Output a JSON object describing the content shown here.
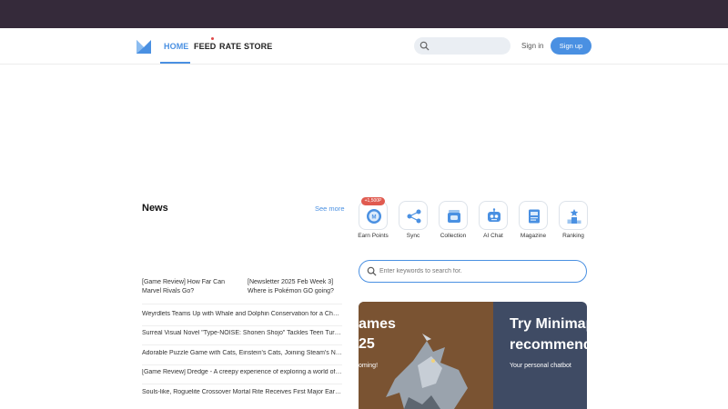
{
  "nav": {
    "links": [
      "HOME",
      "FEED",
      "RATE",
      "STORE"
    ],
    "sign_in": "Sign in",
    "sign_up": "Sign up",
    "accent": "#4a90e2"
  },
  "news": {
    "title": "News",
    "see_more": "See more",
    "featured": [
      "[Game Review] How Far Can Marvel Rivals Go?",
      "[Newsletter 2025 Feb Week 3] Where is Pokémon GO going?"
    ],
    "items": [
      "Weyrdlets Teams Up with Whale and Dolphin Conservation for a Charity Event",
      "Surreal Visual Novel \"Type-NOISE: Shonen Shojo\" Tackles Teen Turmoil Head-On",
      "Adorable Puzzle Game with Cats, Einstein's Cats, Joining Steam's Next Fest",
      "[Game Review] Dredge - A creepy experience of exploring a world of mystery",
      "Souls-like, Roguelite Crossover Mortal Rite Receives First Major Early Access Update"
    ]
  },
  "quick_links": {
    "badge": "+1,500P",
    "items": [
      {
        "label": "Earn Points",
        "icon": "points-icon"
      },
      {
        "label": "Sync",
        "icon": "sync-icon"
      },
      {
        "label": "Collection",
        "icon": "collection-icon"
      },
      {
        "label": "AI Chat",
        "icon": "robot-icon"
      },
      {
        "label": "Magazine",
        "icon": "magazine-icon"
      },
      {
        "label": "Ranking",
        "icon": "ranking-icon"
      }
    ]
  },
  "search": {
    "placeholder": "Enter keywords to search for."
  },
  "banner": {
    "left_line1": "ames",
    "left_line2": "25",
    "left_line3": "oming!",
    "right_line1": "Try Minimap",
    "right_line2": "recommenda",
    "right_line3": "Your personal chatbot"
  }
}
